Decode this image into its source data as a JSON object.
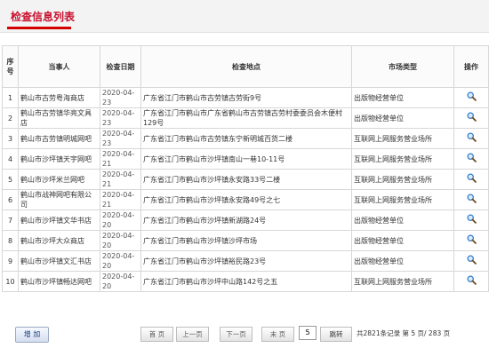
{
  "header": {
    "title": "检查信息列表"
  },
  "table": {
    "columns": [
      "序号",
      "当事人",
      "检查日期",
      "检查地点",
      "市场类型",
      "操作"
    ],
    "rows": [
      {
        "no": "1",
        "party": "鹤山市古劳粤海商店",
        "date": "2020-04-23",
        "location": "广东省江门市鹤山市古劳镇古劳街9号",
        "market": "出版物经营单位"
      },
      {
        "no": "2",
        "party": "鹤山市古劳镇华亮文具店",
        "date": "2020-04-23",
        "location": "广东省江门市鹤山市广东省鹤山市古劳镇古劳村委委员会木便村129号",
        "market": "出版物经营单位"
      },
      {
        "no": "3",
        "party": "鹤山市古劳镇明城网吧",
        "date": "2020-04-23",
        "location": "广东省江门市鹤山市古劳镇东宁新明城百货二楼",
        "market": "互联网上网服务营业场所"
      },
      {
        "no": "4",
        "party": "鹤山市沙坪镇天宇网吧",
        "date": "2020-04-21",
        "location": "广东省江门市鹤山市沙坪镇南山一巷10-11号",
        "market": "互联网上网服务营业场所"
      },
      {
        "no": "5",
        "party": "鹤山市沙坪米兰网吧",
        "date": "2020-04-21",
        "location": "广东省江门市鹤山市沙坪镇永安路33号二楼",
        "market": "互联网上网服务营业场所"
      },
      {
        "no": "6",
        "party": "鹤山市战神网吧有限公司",
        "date": "2020-04-21",
        "location": "广东省江门市鹤山市沙坪镇永安路49号之七",
        "market": "互联网上网服务营业场所"
      },
      {
        "no": "7",
        "party": "鹤山市沙坪镇文华书店",
        "date": "2020-04-20",
        "location": "广东省江门市鹤山市沙坪镇新湖路24号",
        "market": "出版物经营单位"
      },
      {
        "no": "8",
        "party": "鹤山市沙坪大众商店",
        "date": "2020-04-20",
        "location": "广东省江门市鹤山市沙坪镇沙坪市场",
        "market": "出版物经营单位"
      },
      {
        "no": "9",
        "party": "鹤山市沙坪镇文汇书店",
        "date": "2020-04-20",
        "location": "广东省江门市鹤山市沙坪镇裕民路23号",
        "market": "出版物经营单位"
      },
      {
        "no": "10",
        "party": "鹤山市沙坪镇畅达网吧",
        "date": "2020-04-20",
        "location": "广东省江门市鹤山市沙坪中山路142号之五",
        "market": "互联网上网服务营业场所"
      }
    ]
  },
  "footer": {
    "add_label": "增 加",
    "first_label": "首 页",
    "prev_label": "上一页",
    "next_label": "下一页",
    "last_label": "末 页",
    "page_value": "5",
    "go_label": "跳转",
    "info": "共2821条记录 第 5 页/ 283 页"
  },
  "colors": {
    "title": "#c8102e",
    "accent": "#d40000"
  },
  "icons": {
    "view": "magnifier-icon"
  }
}
